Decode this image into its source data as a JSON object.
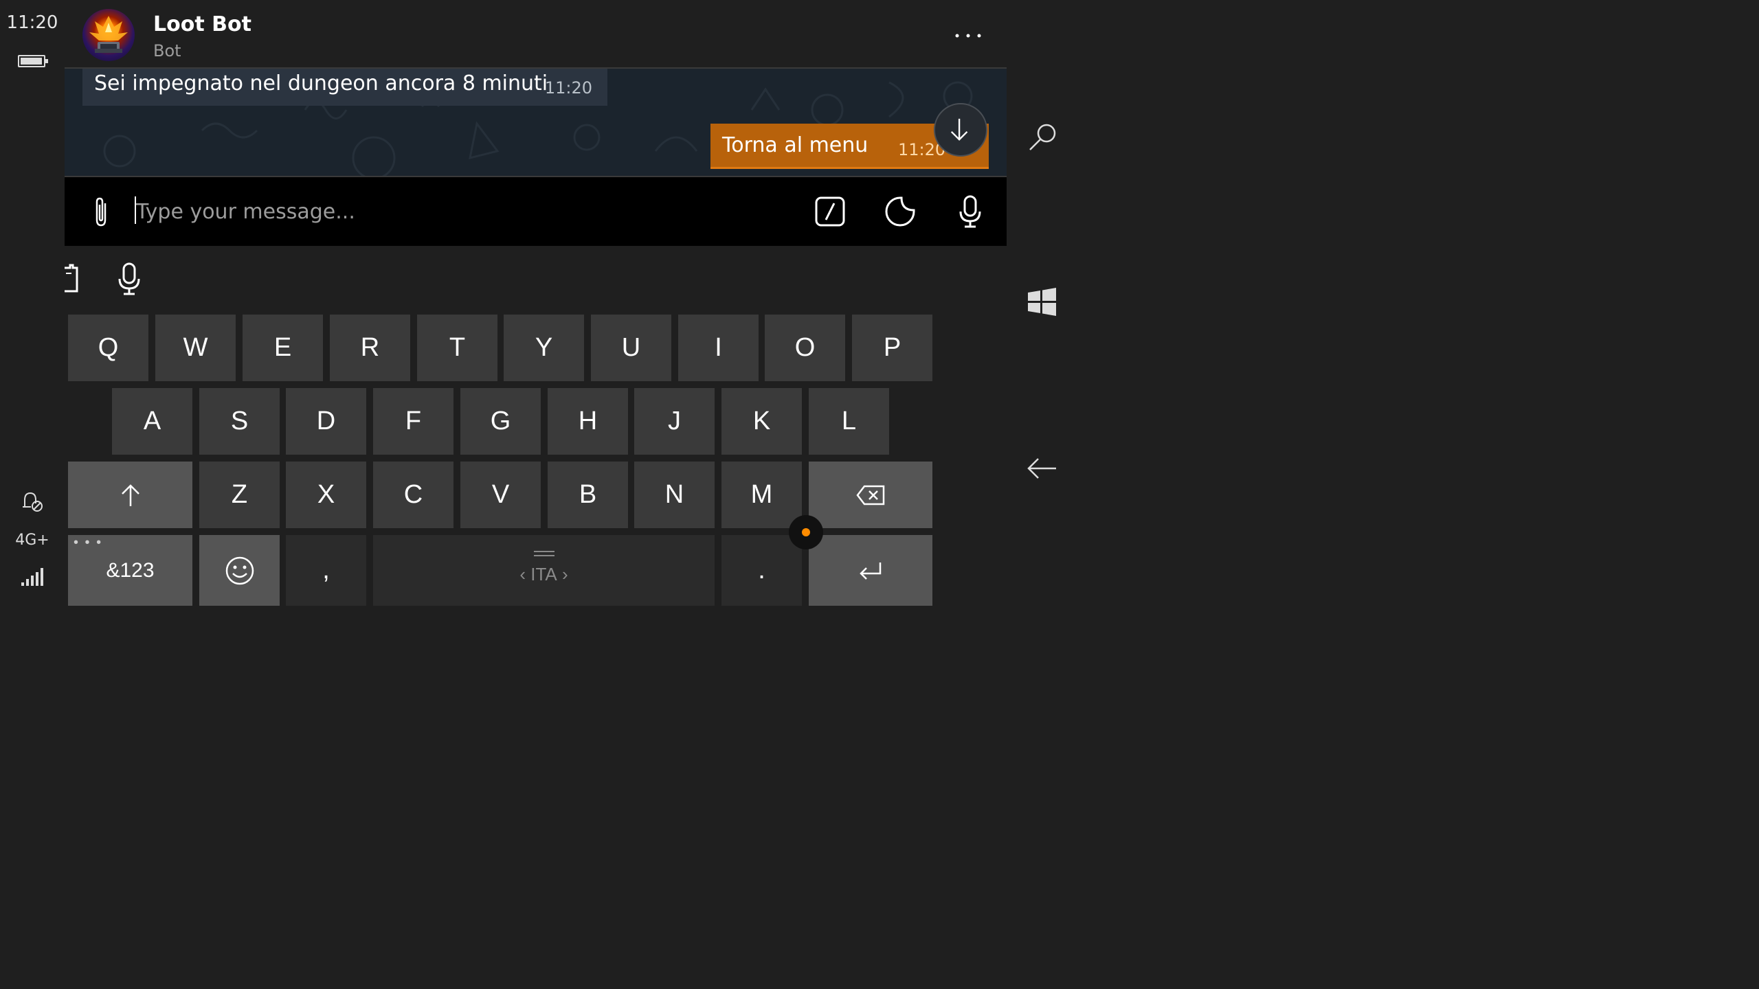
{
  "status_bar": {
    "time": "11:20",
    "battery_icon": "battery-icon",
    "quiet_icon": "quiet-hours-icon",
    "network": "4G+",
    "signal_icon": "signal-icon"
  },
  "chat": {
    "title": "Loot Bot",
    "subtitle": "Bot",
    "more_icon": "more-options-icon"
  },
  "messages": [
    {
      "direction": "incoming",
      "text": "Sei impegnato nel dungeon ancora 8 minuti",
      "time": "11:20"
    },
    {
      "direction": "outgoing",
      "text": "Torna al menu",
      "time": "11:20"
    }
  ],
  "composer": {
    "placeholder": "Type your message...",
    "value": "",
    "buttons": [
      "attach-icon",
      "bot-command-icon",
      "sticker-icon",
      "microphone-icon"
    ]
  },
  "keyboard": {
    "toolbar": [
      "clipboard-icon",
      "voice-typing-icon"
    ],
    "rows": [
      [
        "Q",
        "W",
        "E",
        "R",
        "T",
        "Y",
        "U",
        "I",
        "O",
        "P"
      ],
      [
        "A",
        "S",
        "D",
        "F",
        "G",
        "H",
        "J",
        "K",
        "L"
      ],
      [
        "Z",
        "X",
        "C",
        "V",
        "B",
        "N",
        "M"
      ]
    ],
    "symbols_label": "&123",
    "comma": ",",
    "period": ".",
    "language": "ITA",
    "lang_prev": "‹",
    "lang_next": "›",
    "sym_dots": "• • •"
  },
  "nav_bar": {
    "search_icon": "search-icon",
    "start_icon": "windows-icon",
    "back_icon": "back-arrow-icon"
  },
  "colors": {
    "accent": "#b8620b",
    "outgoing_bubble": "#b8620b",
    "incoming_bubble": "#2b3440",
    "chat_background": "#1b242d",
    "key": "#3a3a3a",
    "modifier_key": "#555555",
    "handle_dot": "#ff8c00"
  }
}
